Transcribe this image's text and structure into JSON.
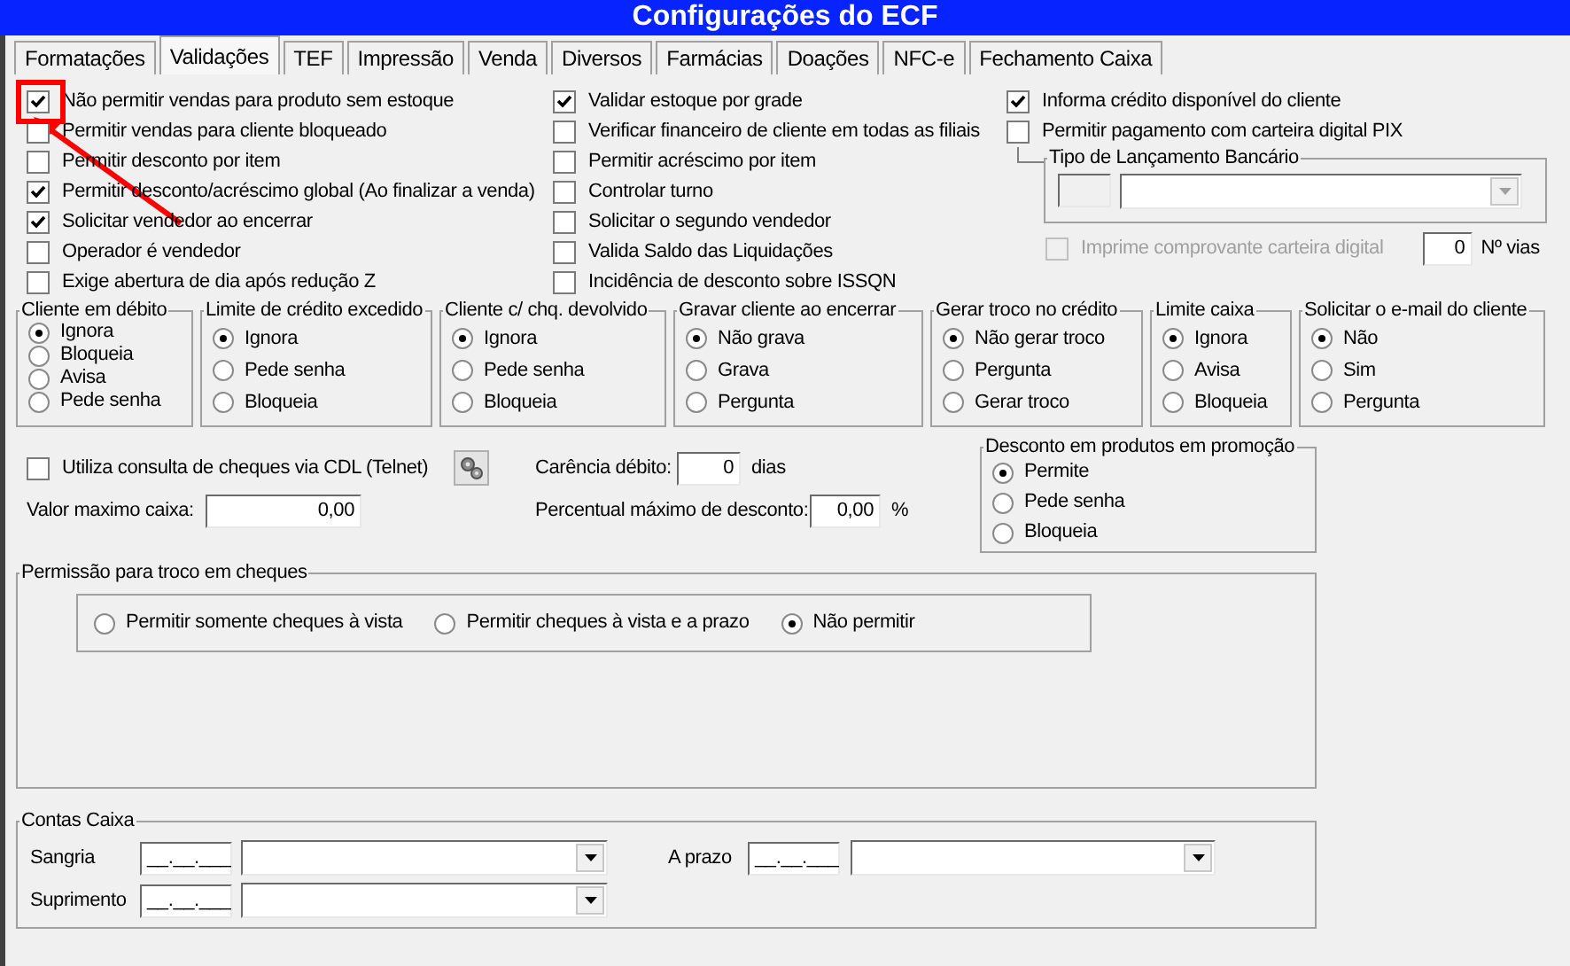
{
  "window": {
    "title": "Configurações do ECF"
  },
  "tabs": [
    {
      "label": "Formatações",
      "selected": false
    },
    {
      "label": "Validações",
      "selected": true
    },
    {
      "label": "TEF",
      "selected": false
    },
    {
      "label": "Impressão",
      "selected": false
    },
    {
      "label": "Venda",
      "selected": false
    },
    {
      "label": "Diversos",
      "selected": false
    },
    {
      "label": "Farmácias",
      "selected": false
    },
    {
      "label": "Doações",
      "selected": false
    },
    {
      "label": "NFC-e",
      "selected": false
    },
    {
      "label": "Fechamento Caixa",
      "selected": false
    }
  ],
  "option_columns": [
    {
      "items": [
        {
          "label": "Não permitir vendas para produto sem estoque",
          "checked": true
        },
        {
          "label": "Permitir vendas para cliente bloqueado",
          "checked": false
        },
        {
          "label": "Permitir desconto por item",
          "checked": false
        },
        {
          "label": "Permitir desconto/acréscimo global (Ao finalizar a venda)",
          "checked": true
        },
        {
          "label": "Solicitar vendedor ao encerrar",
          "checked": true
        },
        {
          "label": "Operador é vendedor",
          "checked": false
        },
        {
          "label": "Exige abertura de dia após redução Z",
          "checked": false
        }
      ]
    },
    {
      "items": [
        {
          "label": "Validar estoque por grade",
          "checked": true
        },
        {
          "label": "Verificar financeiro de cliente em todas as filiais",
          "checked": false
        },
        {
          "label": "Permitir acréscimo por item",
          "checked": false
        },
        {
          "label": "Controlar turno",
          "checked": false
        },
        {
          "label": "Solicitar o segundo vendedor",
          "checked": false
        },
        {
          "label": "Valida Saldo das Liquidações",
          "checked": false
        },
        {
          "label": "Incidência de desconto sobre ISSQN",
          "checked": false
        }
      ]
    },
    {
      "items": [
        {
          "label": "Informa crédito disponível do cliente",
          "checked": true
        },
        {
          "label": "Permitir pagamento com carteira digital PIX",
          "checked": false
        }
      ]
    }
  ],
  "bank_entry_group": {
    "title": "Tipo de Lançamento Bancário",
    "disabled": true
  },
  "print_receipt": {
    "label": "Imprime comprovante carteira digital",
    "checked": false,
    "disabled": true
  },
  "copies": {
    "value": "0",
    "label": "Nº vias"
  },
  "radio_groups": [
    {
      "title": "Cliente em débito",
      "options": [
        {
          "label": "Ignora",
          "selected": true
        },
        {
          "label": "Bloqueia",
          "selected": false
        },
        {
          "label": "Avisa",
          "selected": false
        },
        {
          "label": "Pede senha",
          "selected": false
        }
      ]
    },
    {
      "title": "Limite de crédito excedido",
      "options": [
        {
          "label": "Ignora",
          "selected": true
        },
        {
          "label": "Pede senha",
          "selected": false
        },
        {
          "label": "Bloqueia",
          "selected": false
        }
      ]
    },
    {
      "title": "Cliente c/ chq. devolvido",
      "options": [
        {
          "label": "Ignora",
          "selected": true
        },
        {
          "label": "Pede senha",
          "selected": false
        },
        {
          "label": "Bloqueia",
          "selected": false
        }
      ]
    },
    {
      "title": "Gravar cliente ao encerrar",
      "options": [
        {
          "label": "Não grava",
          "selected": true
        },
        {
          "label": "Grava",
          "selected": false
        },
        {
          "label": "Pergunta",
          "selected": false
        }
      ]
    },
    {
      "title": "Gerar troco no crédito",
      "options": [
        {
          "label": "Não gerar troco",
          "selected": true
        },
        {
          "label": "Pergunta",
          "selected": false
        },
        {
          "label": "Gerar troco",
          "selected": false
        }
      ]
    },
    {
      "title": "Limite caixa",
      "options": [
        {
          "label": "Ignora",
          "selected": true
        },
        {
          "label": "Avisa",
          "selected": false
        },
        {
          "label": "Bloqueia",
          "selected": false
        }
      ]
    },
    {
      "title": "Solicitar o e-mail do cliente",
      "options": [
        {
          "label": "Não",
          "selected": true
        },
        {
          "label": "Sim",
          "selected": false
        },
        {
          "label": "Pergunta",
          "selected": false
        }
      ]
    }
  ],
  "cdl": {
    "label": "Utiliza consulta de cheques via CDL (Telnet)",
    "checked": false
  },
  "grace_debit": {
    "label": "Carência débito:",
    "value": "0",
    "unit": "dias"
  },
  "max_cash": {
    "label": "Valor maximo caixa:",
    "value": "0,00"
  },
  "max_discount": {
    "label": "Percentual máximo de desconto:",
    "value": "0,00",
    "unit": "%"
  },
  "promo_discount": {
    "title": "Desconto em produtos em promoção",
    "options": [
      {
        "label": "Permite",
        "selected": true
      },
      {
        "label": "Pede senha",
        "selected": false
      },
      {
        "label": "Bloqueia",
        "selected": false
      }
    ]
  },
  "check_change": {
    "title": "Permissão para troco em cheques",
    "options": [
      {
        "label": "Permitir somente cheques à vista",
        "selected": false
      },
      {
        "label": "Permitir cheques à vista e a prazo",
        "selected": false
      },
      {
        "label": "Não permitir",
        "selected": true
      }
    ]
  },
  "cash_accounts": {
    "title": "Contas Caixa",
    "rows": [
      {
        "label": "Sangria",
        "mask": "__.__.___"
      },
      {
        "label": "Suprimento",
        "mask": "__.__.___"
      }
    ],
    "term": {
      "label": "A prazo",
      "mask": "__.__.___"
    }
  }
}
